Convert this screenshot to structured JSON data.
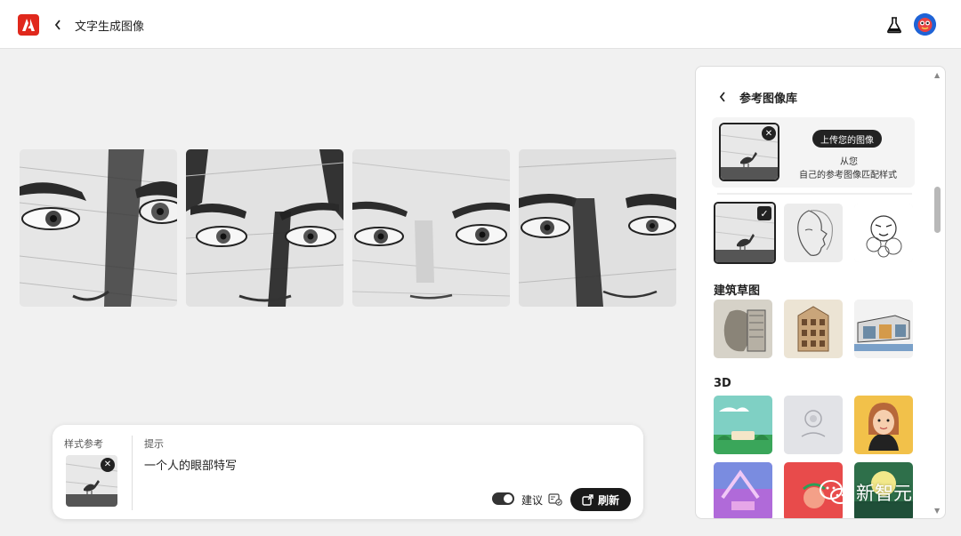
{
  "header": {
    "title": "文字生成图像",
    "logo_icon": "adobe-logo-icon",
    "lab_icon": "flask-icon",
    "brand_color": "#e0281c"
  },
  "results": {
    "images": [
      {
        "name": "generated-image-1"
      },
      {
        "name": "generated-image-2"
      },
      {
        "name": "generated-image-3"
      },
      {
        "name": "generated-image-4"
      }
    ]
  },
  "prompt_bar": {
    "style_ref_label": "样式参考",
    "prompt_label": "提示",
    "prompt_text": "一个人的眼部特写",
    "suggest_label": "建议",
    "suggest_on": true,
    "refresh_label": "刷新"
  },
  "panel": {
    "title": "参考图像库",
    "upload_button": "上传您的图像",
    "upload_line1": "从您",
    "upload_line2": "自己的参考图像匹配样式",
    "section_architecture": "建筑草图",
    "section_3d": "3D"
  },
  "watermark": {
    "text": "新智元"
  }
}
